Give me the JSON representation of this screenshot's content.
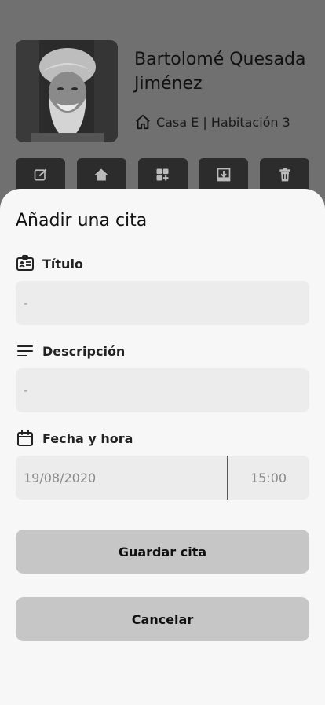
{
  "profile": {
    "name": "Bartolomé Quesada Jiménez",
    "location": "Casa E | Habitación 3",
    "photo_icon": "elderly-man-portrait",
    "location_icon": "home-outline-icon"
  },
  "actions": [
    {
      "icon": "edit-icon"
    },
    {
      "icon": "home-icon"
    },
    {
      "icon": "apps-add-icon"
    },
    {
      "icon": "download-icon"
    },
    {
      "icon": "trash-icon"
    }
  ],
  "sheet": {
    "title": "Añadir una cita",
    "title_field": {
      "label": "Título",
      "value": "-",
      "icon": "id-card-icon"
    },
    "description_field": {
      "label": "Descripción",
      "value": "-",
      "icon": "lines-icon"
    },
    "datetime_field": {
      "label": "Fecha y hora",
      "date": "19/08/2020",
      "time": "15:00",
      "icon": "calendar-icon"
    },
    "save_label": "Guardar cita",
    "cancel_label": "Cancelar"
  },
  "colors": {
    "overlay_bg": "#707070",
    "sheet_bg": "#f7f7f7",
    "input_bg": "#ececec",
    "button_bg": "#c6c6c6",
    "action_bg": "#2c2c2c"
  }
}
